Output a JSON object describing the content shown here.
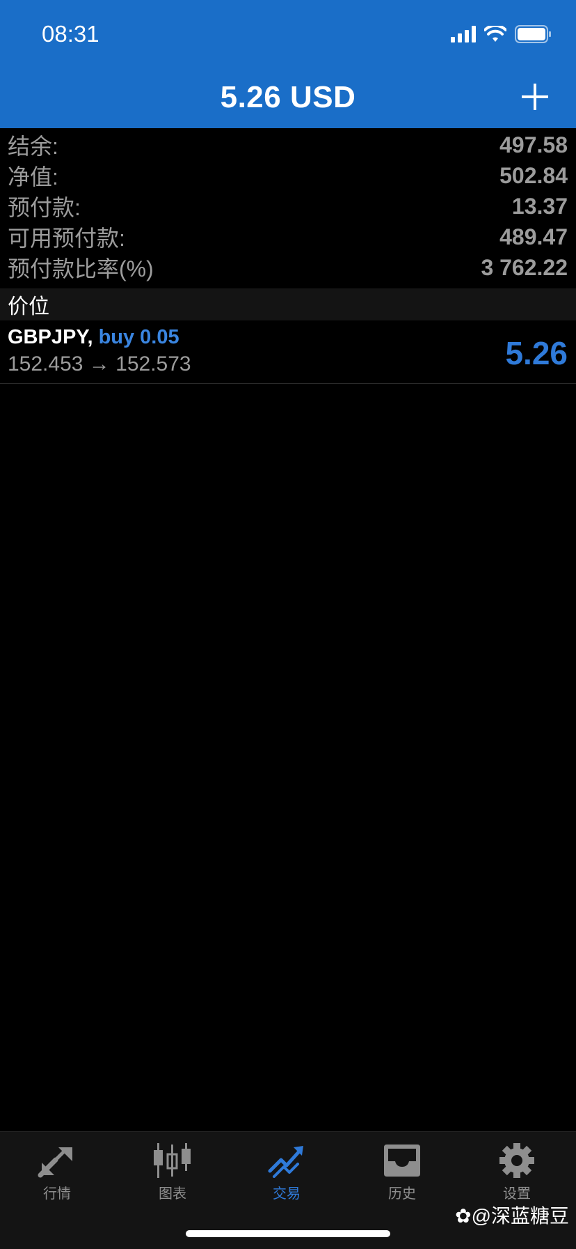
{
  "status_bar": {
    "time": "08:31"
  },
  "header": {
    "title": "5.26 USD"
  },
  "summary": [
    {
      "label": "结余:",
      "value": "497.58"
    },
    {
      "label": "净值:",
      "value": "502.84"
    },
    {
      "label": "预付款:",
      "value": "13.37"
    },
    {
      "label": "可用预付款:",
      "value": "489.47"
    },
    {
      "label": "预付款比率(%)",
      "value": "3 762.22"
    }
  ],
  "section": {
    "title": "价位"
  },
  "position": {
    "symbol": "GBPJPY,",
    "direction": "buy 0.05",
    "open_price": "152.453",
    "arrow": "→",
    "current_price": "152.573",
    "profit": "5.26"
  },
  "tabs": [
    {
      "label": "行情",
      "icon": "quotes-icon",
      "active": false
    },
    {
      "label": "图表",
      "icon": "chart-candles-icon",
      "active": false
    },
    {
      "label": "交易",
      "icon": "trade-icon",
      "active": true
    },
    {
      "label": "历史",
      "icon": "history-inbox-icon",
      "active": false
    },
    {
      "label": "设置",
      "icon": "gear-icon",
      "active": false
    }
  ],
  "watermark": "@深蓝糖豆",
  "colors": {
    "header_bg": "#1a6ec8",
    "accent": "#2f7ad9",
    "muted": "#9c9c9c"
  }
}
